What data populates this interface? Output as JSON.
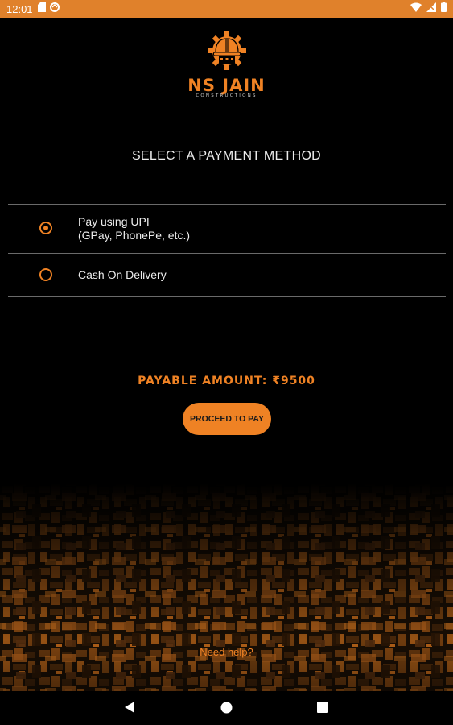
{
  "status_bar": {
    "time": "12:01",
    "background_color": "#e0812b",
    "left_icons": [
      "sd-card-icon",
      "sync-icon"
    ],
    "right_icons": [
      "wifi-icon",
      "signal-icon",
      "battery-icon"
    ]
  },
  "brand": {
    "name": "NS JAIN",
    "tagline": "CONSTRUCTIONS",
    "accent_color": "#ef8224"
  },
  "payment": {
    "title": "SELECT A PAYMENT METHOD",
    "options": [
      {
        "line1": "Pay using UPI",
        "line2": "(GPay, PhonePe, etc.)",
        "selected": true
      },
      {
        "line1": "Cash On Delivery",
        "line2": "",
        "selected": false
      }
    ]
  },
  "amount": {
    "label": "PAYABLE AMOUNT: ₹9500",
    "proceed_label": "PROCEED TO PAY"
  },
  "footer": {
    "help_label": "Need help?"
  },
  "nav_bar": {
    "buttons": [
      "back-icon",
      "home-icon",
      "recents-icon"
    ]
  }
}
